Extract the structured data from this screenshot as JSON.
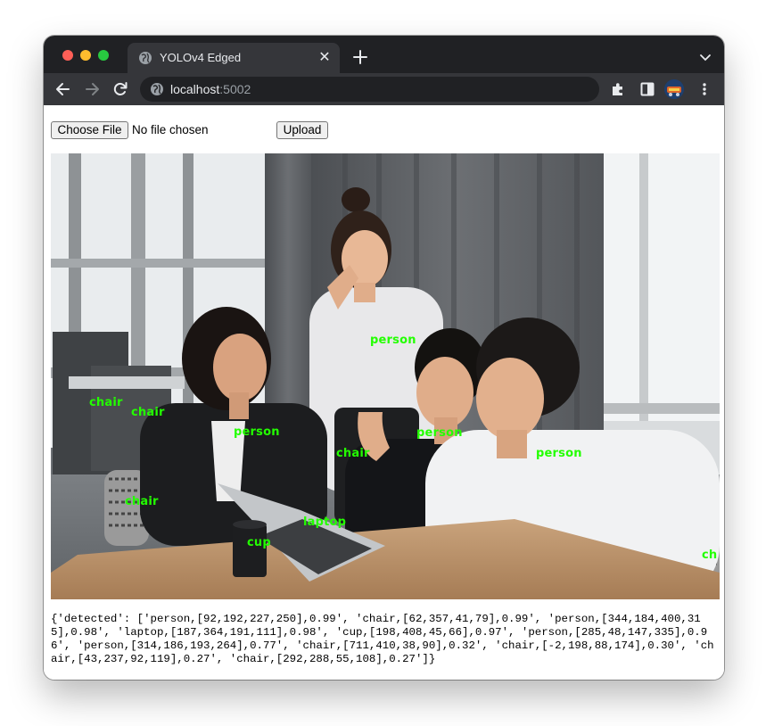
{
  "browser": {
    "tab_title": "YOLOv4 Edged",
    "tab_close": "✕",
    "url_host": "localhost",
    "url_port": ":5002"
  },
  "form": {
    "choose_file_label": "Choose File",
    "no_file_text": "No file chosen",
    "upload_label": "Upload"
  },
  "image": {
    "labels": [
      {
        "text": "person"
      },
      {
        "text": "chair"
      },
      {
        "text": "chair"
      },
      {
        "text": "person"
      },
      {
        "text": "chair"
      },
      {
        "text": "person"
      },
      {
        "text": "person"
      },
      {
        "text": "chair"
      },
      {
        "text": "laptop"
      },
      {
        "text": "cup"
      },
      {
        "text": "ch"
      }
    ]
  },
  "result": {
    "detected_text": "{'detected': ['person,[92,192,227,250],0.99', 'chair,[62,357,41,79],0.99', 'person,[344,184,400,315],0.98', 'laptop,[187,364,191,111],0.98', 'cup,[198,408,45,66],0.97', 'person,[285,48,147,335],0.96', 'person,[314,186,193,264],0.77', 'chair,[711,410,38,90],0.32', 'chair,[-2,198,88,174],0.30', 'chair,[43,237,92,119],0.27', 'chair,[292,288,55,108],0.27']}"
  },
  "colors": {
    "label_green": "#23ff00",
    "tabbar": "#202124",
    "toolbar": "#35363a"
  }
}
